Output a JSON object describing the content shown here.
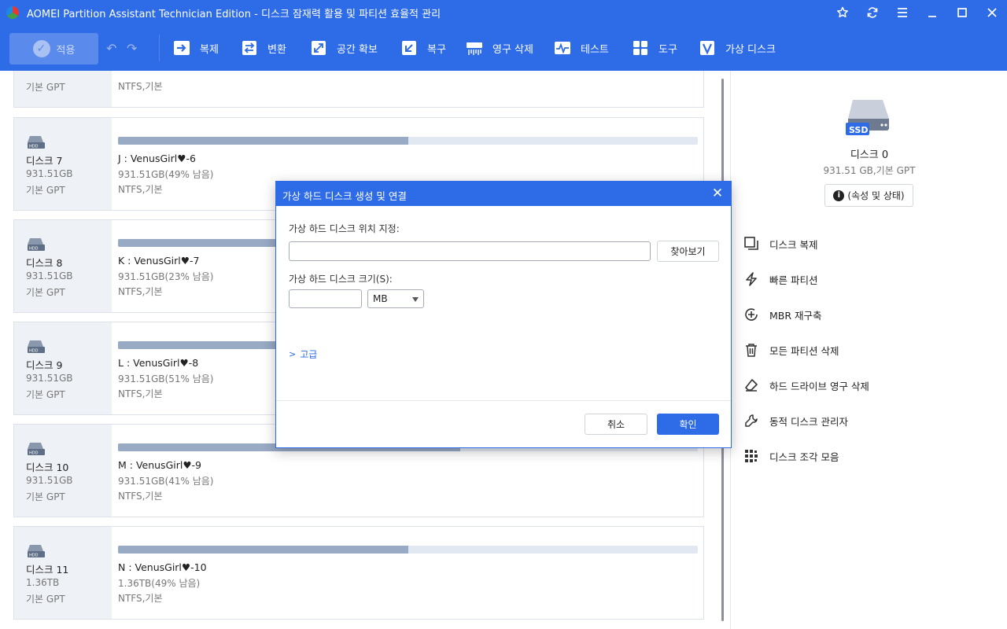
{
  "window": {
    "title": "AOMEI Partition Assistant Technician Edition - 디스크 잠재력 활용 및 파티션 효율적 관리"
  },
  "toolbar": {
    "apply_label": "적용",
    "tools": [
      {
        "label": "복제",
        "icon": "clone-icon"
      },
      {
        "label": "변환",
        "icon": "convert-icon"
      },
      {
        "label": "공간 확보",
        "icon": "free-space-icon"
      },
      {
        "label": "복구",
        "icon": "recover-icon"
      },
      {
        "label": "영구 삭제",
        "icon": "shred-icon"
      },
      {
        "label": "테스트",
        "icon": "test-icon"
      },
      {
        "label": "도구",
        "icon": "tools-icon"
      },
      {
        "label": "가상 디스크",
        "icon": "virtual-disk-icon"
      }
    ]
  },
  "disk_list": {
    "top_partial": {
      "disk_type": "기본 GPT",
      "fs": "NTFS,기본"
    },
    "disks": [
      {
        "name": "디스크 7",
        "size": "931.51GB",
        "type": "기본 GPT",
        "partition": "J : VenusGirl♥-6",
        "part_size": "931.51GB(49% 남음)",
        "fs": "NTFS,기본",
        "used_pct": 50
      },
      {
        "name": "디스크 8",
        "size": "931.51GB",
        "type": "기본 GPT",
        "partition": "K : VenusGirl♥-7",
        "part_size": "931.51GB(23% 남음)",
        "fs": "NTFS,기본",
        "used_pct": 77
      },
      {
        "name": "디스크 9",
        "size": "931.51GB",
        "type": "기본 GPT",
        "partition": "L : VenusGirl♥-8",
        "part_size": "931.51GB(51% 남음)",
        "fs": "NTFS,기본",
        "used_pct": 49
      },
      {
        "name": "디스크 10",
        "size": "931.51GB",
        "type": "기본 GPT",
        "partition": "M : VenusGirl♥-9",
        "part_size": "931.51GB(41% 남음)",
        "fs": "NTFS,기본",
        "used_pct": 59
      },
      {
        "name": "디스크 11",
        "size": "1.36TB",
        "type": "기본 GPT",
        "partition": "N : VenusGirl♥-10",
        "part_size": "1.36TB(49% 남음)",
        "fs": "NTFS,기본",
        "used_pct": 50
      }
    ]
  },
  "right_panel": {
    "disk_name": "디스크 0",
    "disk_detail": "931.51 GB,기본 GPT",
    "properties_label": "(속성 및 상태)",
    "ssd_label": "SSD",
    "operations": [
      {
        "label": "디스크 복제",
        "icon": "disk-clone-icon"
      },
      {
        "label": "빠른 파티션",
        "icon": "quick-partition-icon"
      },
      {
        "label": "MBR 재구축",
        "icon": "rebuild-mbr-icon"
      },
      {
        "label": "모든 파티션 삭제",
        "icon": "delete-all-partitions-icon"
      },
      {
        "label": "하드 드라이브 영구 삭제",
        "icon": "wipe-drive-icon"
      },
      {
        "label": "동적 디스크 관리자",
        "icon": "dynamic-disk-icon"
      },
      {
        "label": "디스크 조각 모음",
        "icon": "defrag-icon"
      }
    ]
  },
  "dialog": {
    "title": "가상 하드 디스크 생성 및 연결",
    "location_label": "가상 하드 디스크 위치 지정:",
    "location_value": "",
    "browse_label": "찾아보기",
    "size_label": "가상 하드 디스크 크기(S):",
    "size_value": "",
    "unit_selected": "MB",
    "advanced_label": "고급",
    "cancel_label": "취소",
    "ok_label": "확인"
  },
  "colors": {
    "accent": "#2e6be6",
    "bar_fill": "#98aac4",
    "bar_track": "#e2e8f2",
    "disk_panel_bg": "#eef1f6"
  }
}
